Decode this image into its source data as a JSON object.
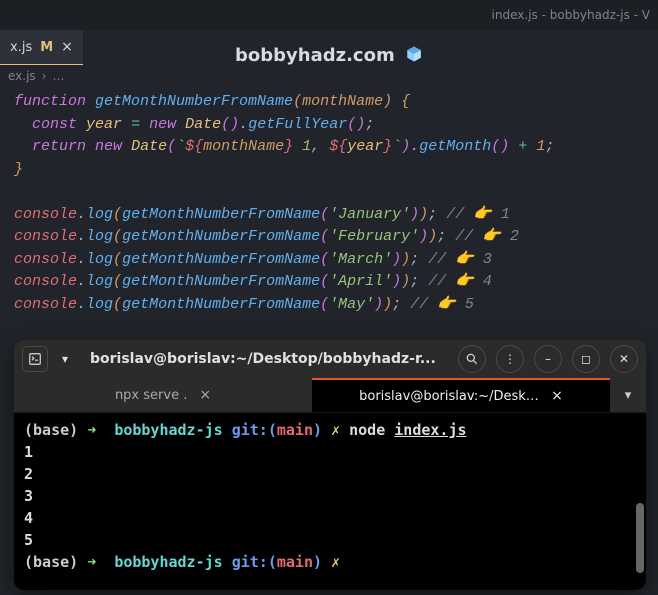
{
  "window": {
    "title": "index.js - bobbyhadz-js - V"
  },
  "tab": {
    "name": "x.js",
    "modified": "M"
  },
  "watermark": "bobbyhadz.com",
  "breadcrumb": {
    "file": "ex.js",
    "sep": "›",
    "more": "…"
  },
  "code": {
    "fn_kw": "function",
    "fn_name": "getMonthNumberFromName",
    "param": "monthName",
    "const_kw": "const",
    "var_year": "year",
    "new_kw": "new",
    "date_cls": "Date",
    "getFullYear": "getFullYear",
    "return_kw": "return",
    "tmpl_open": "`${",
    "tmpl_mid": "} 1, ${",
    "tmpl_close": "}`",
    "getMonth": "getMonth",
    "plus_one": "1",
    "console": "console",
    "log": "log",
    "calls": [
      {
        "arg": "'January'",
        "note": "1"
      },
      {
        "arg": "'February'",
        "note": "2"
      },
      {
        "arg": "'March'",
        "note": "3"
      },
      {
        "arg": "'April'",
        "note": "4"
      },
      {
        "arg": "'May'",
        "note": "5"
      }
    ]
  },
  "terminal": {
    "title": "borislav@borislav:~/Desktop/bobbyhadz-r...",
    "tabs": {
      "inactive": "npx serve .",
      "active": "borislav@borislav:~/Desktop/b…"
    },
    "prompt": {
      "base": "(base)",
      "arrow": "➜",
      "dir": "bobbyhadz-js",
      "git": "git:(",
      "branch": "main",
      "git_close": ")",
      "sym": "✗"
    },
    "cmd": "node",
    "file": "index.js",
    "output": [
      "1",
      "2",
      "3",
      "4",
      "5"
    ]
  }
}
